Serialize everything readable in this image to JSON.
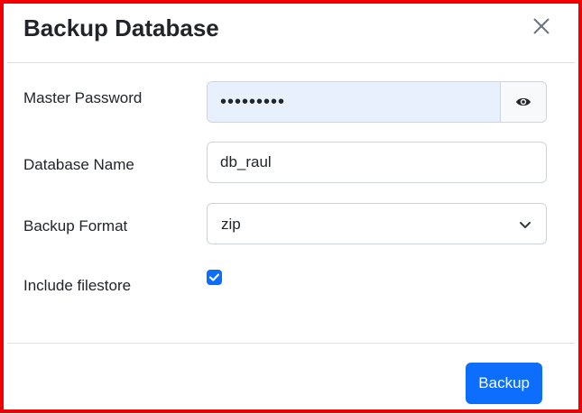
{
  "modal": {
    "title": "Backup Database",
    "close_icon": "close-icon"
  },
  "form": {
    "master_password": {
      "label": "Master Password",
      "value": "•••••••••",
      "toggle_icon": "eye-icon"
    },
    "database_name": {
      "label": "Database Name",
      "value": "db_raul"
    },
    "backup_format": {
      "label": "Backup Format",
      "selected": "zip",
      "icon": "chevron-down-icon"
    },
    "include_filestore": {
      "label": "Include filestore",
      "checked": true
    }
  },
  "footer": {
    "backup_label": "Backup"
  },
  "colors": {
    "accent": "#0d6efd",
    "frame": "#f00000",
    "autofill": "#e8f0fe"
  }
}
